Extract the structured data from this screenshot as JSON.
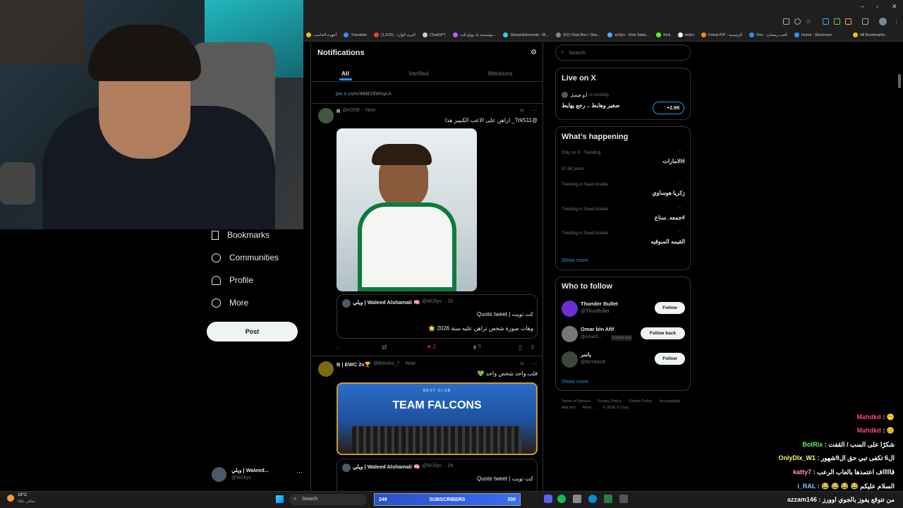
{
  "browser": {
    "bookmarks": [
      "أجهزة الحاسب",
      "Translate",
      "البريد الوارد - (1,815)",
      "ChatGPT",
      "مؤسسة باد وواو للت...",
      "StreamElements - M...",
      "(52) Chat Box / Stre...",
      "w1llyv - Kick Stats...",
      "Kick",
      "botrix",
      "DokanTIP - الرئيسية",
      "Doc - العب رمضان",
      "Home - Restream",
      "All Bookmarks"
    ]
  },
  "nav": {
    "bookmarks": "Bookmarks",
    "communities": "Communities",
    "profile": "Profile",
    "more": "More",
    "post": "Post",
    "account_name": "ويلي | Waleed...",
    "account_handle": "@W1llyv"
  },
  "feed": {
    "title": "Notifications",
    "tabs": [
      "All",
      "Verified",
      "Mentions"
    ],
    "top_link": "pic.x.com/4BB16WxyLk",
    "tweet1": {
      "name": "R",
      "handle": "@irl208",
      "time": "Now",
      "text": "@Trk511_ اراهن على الاعب الكبيير هذا",
      "quote_name": "ويلي | Waleed Alshamali 🧠",
      "quote_handle": "@W1llyv",
      "quote_time": "2h",
      "quote_text1": "كت تويت | Quote tweet",
      "quote_text2": "وهات صورة شخص تراهن عليه سنة 2026 🌟",
      "likes": "2",
      "views": "5"
    },
    "tweet2": {
      "name": "B | EWC 2x🏆",
      "handle": "@Bendro_7",
      "time": "Now",
      "text": "قلب واحد شخص واحد 💚",
      "image_top": "BEST CLUB",
      "image_text": "TEAM FALCONS",
      "quote_name": "ويلي | Waleed Alshamali 🧠",
      "quote_handle": "@W1llyv",
      "quote_time": "2h",
      "quote_text1": "كت تويت | Quote tweet"
    }
  },
  "sidebar": {
    "search_placeholder": "Search",
    "live": {
      "title": "Live on X",
      "host": "أبو فيصل",
      "host_suffix": "is hosting",
      "space_title": "صغير وهابط .. رجع يهايط",
      "listeners": "+2.9K"
    },
    "happening": {
      "title": "What’s happening",
      "trends": [
        {
          "context": "Only on X · Trending",
          "name": "#الامارات",
          "posts": "37.9K posts"
        },
        {
          "context": "Trending in Saudi Arabia",
          "name": "زكريا هوساوي",
          "posts": ""
        },
        {
          "context": "Trending in Saudi Arabia",
          "name": "#جمعه_سناع",
          "posts": ""
        },
        {
          "context": "Trending in Saudi Arabia",
          "name": "القيمه السوقيه",
          "posts": ""
        }
      ],
      "show_more": "Show more"
    },
    "follow": {
      "title": "Who to follow",
      "users": [
        {
          "name": "Thunder Bullet",
          "handle": "@ThunBullet",
          "button": "Follow",
          "badge": ""
        },
        {
          "name": "Omar bin Afif",
          "handle": "@omarfi...",
          "button": "Follow back",
          "badge": "Follows you"
        },
        {
          "name": "ياسر",
          "handle": "@ItsYass3r",
          "button": "Follow",
          "badge": ""
        }
      ],
      "show_more": "Show more"
    },
    "footer": [
      "Terms of Service",
      "Privacy Policy",
      "Cookie Policy",
      "Accessibility",
      "Ads info",
      "More ...",
      "© 2026 X Corp."
    ]
  },
  "chat": [
    {
      "user": "Mahdkd",
      "msg": "😶"
    },
    {
      "user": "Mahdkd",
      "msg": "😊"
    },
    {
      "user": "BotRix",
      "msg": "شكرًا على السب / القفت"
    },
    {
      "user": "OnlyDlx_W1",
      "msg": "ال6 تكفى تبي حق ال9شهور"
    },
    {
      "user": "katty7",
      "msg": "قاااااف اعتمدها بالعاب الرعب"
    },
    {
      "user": "i_RAL",
      "msg": "السلام عليكم 😂 😂 😂 😂"
    },
    {
      "user": "azzam146",
      "msg": "من تتوقع يفوز بالجوي اوورز"
    }
  ],
  "taskbar": {
    "weather_temp": "19°C",
    "weather_desc": "صافي غالبًا",
    "search": "Search",
    "sub_left": "249",
    "sub_label": "SUBSCRIBERS",
    "sub_right": "300"
  }
}
